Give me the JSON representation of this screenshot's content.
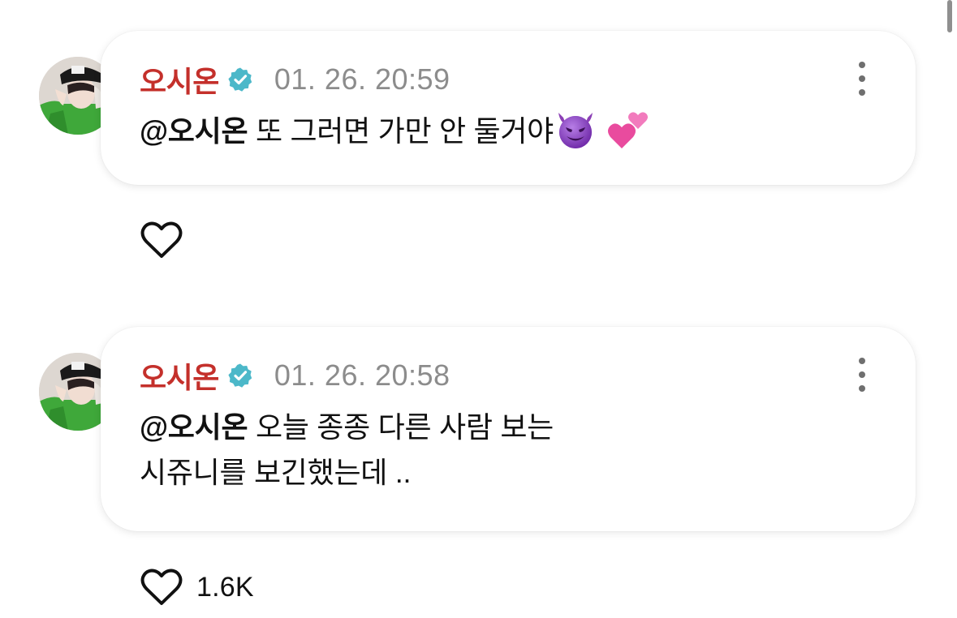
{
  "comments": [
    {
      "author": "오시온",
      "timestamp": "01. 26. 20:59",
      "mention": "@오시온",
      "text": " 또 그러면 가만 안 둘거야",
      "emojis": [
        "smiling-face-with-horns",
        "two-hearts"
      ],
      "likes": "",
      "liked": false
    },
    {
      "author": "오시온",
      "timestamp": "01. 26. 20:58",
      "mention": "@오시온",
      "text_line1": " 오늘 종종 다른 사람 보는",
      "text_line2": "시쥬니를 보긴했는데 ..",
      "likes": "1.6K",
      "liked": false
    }
  ],
  "colors": {
    "author": "#c4302b",
    "timestamp": "#8c8c8c",
    "verified_badge": "#4cb8c9",
    "text": "#111111"
  },
  "icons": {
    "verified": "verified-badge-icon",
    "more": "more-vertical-icon",
    "like": "heart-outline-icon"
  }
}
